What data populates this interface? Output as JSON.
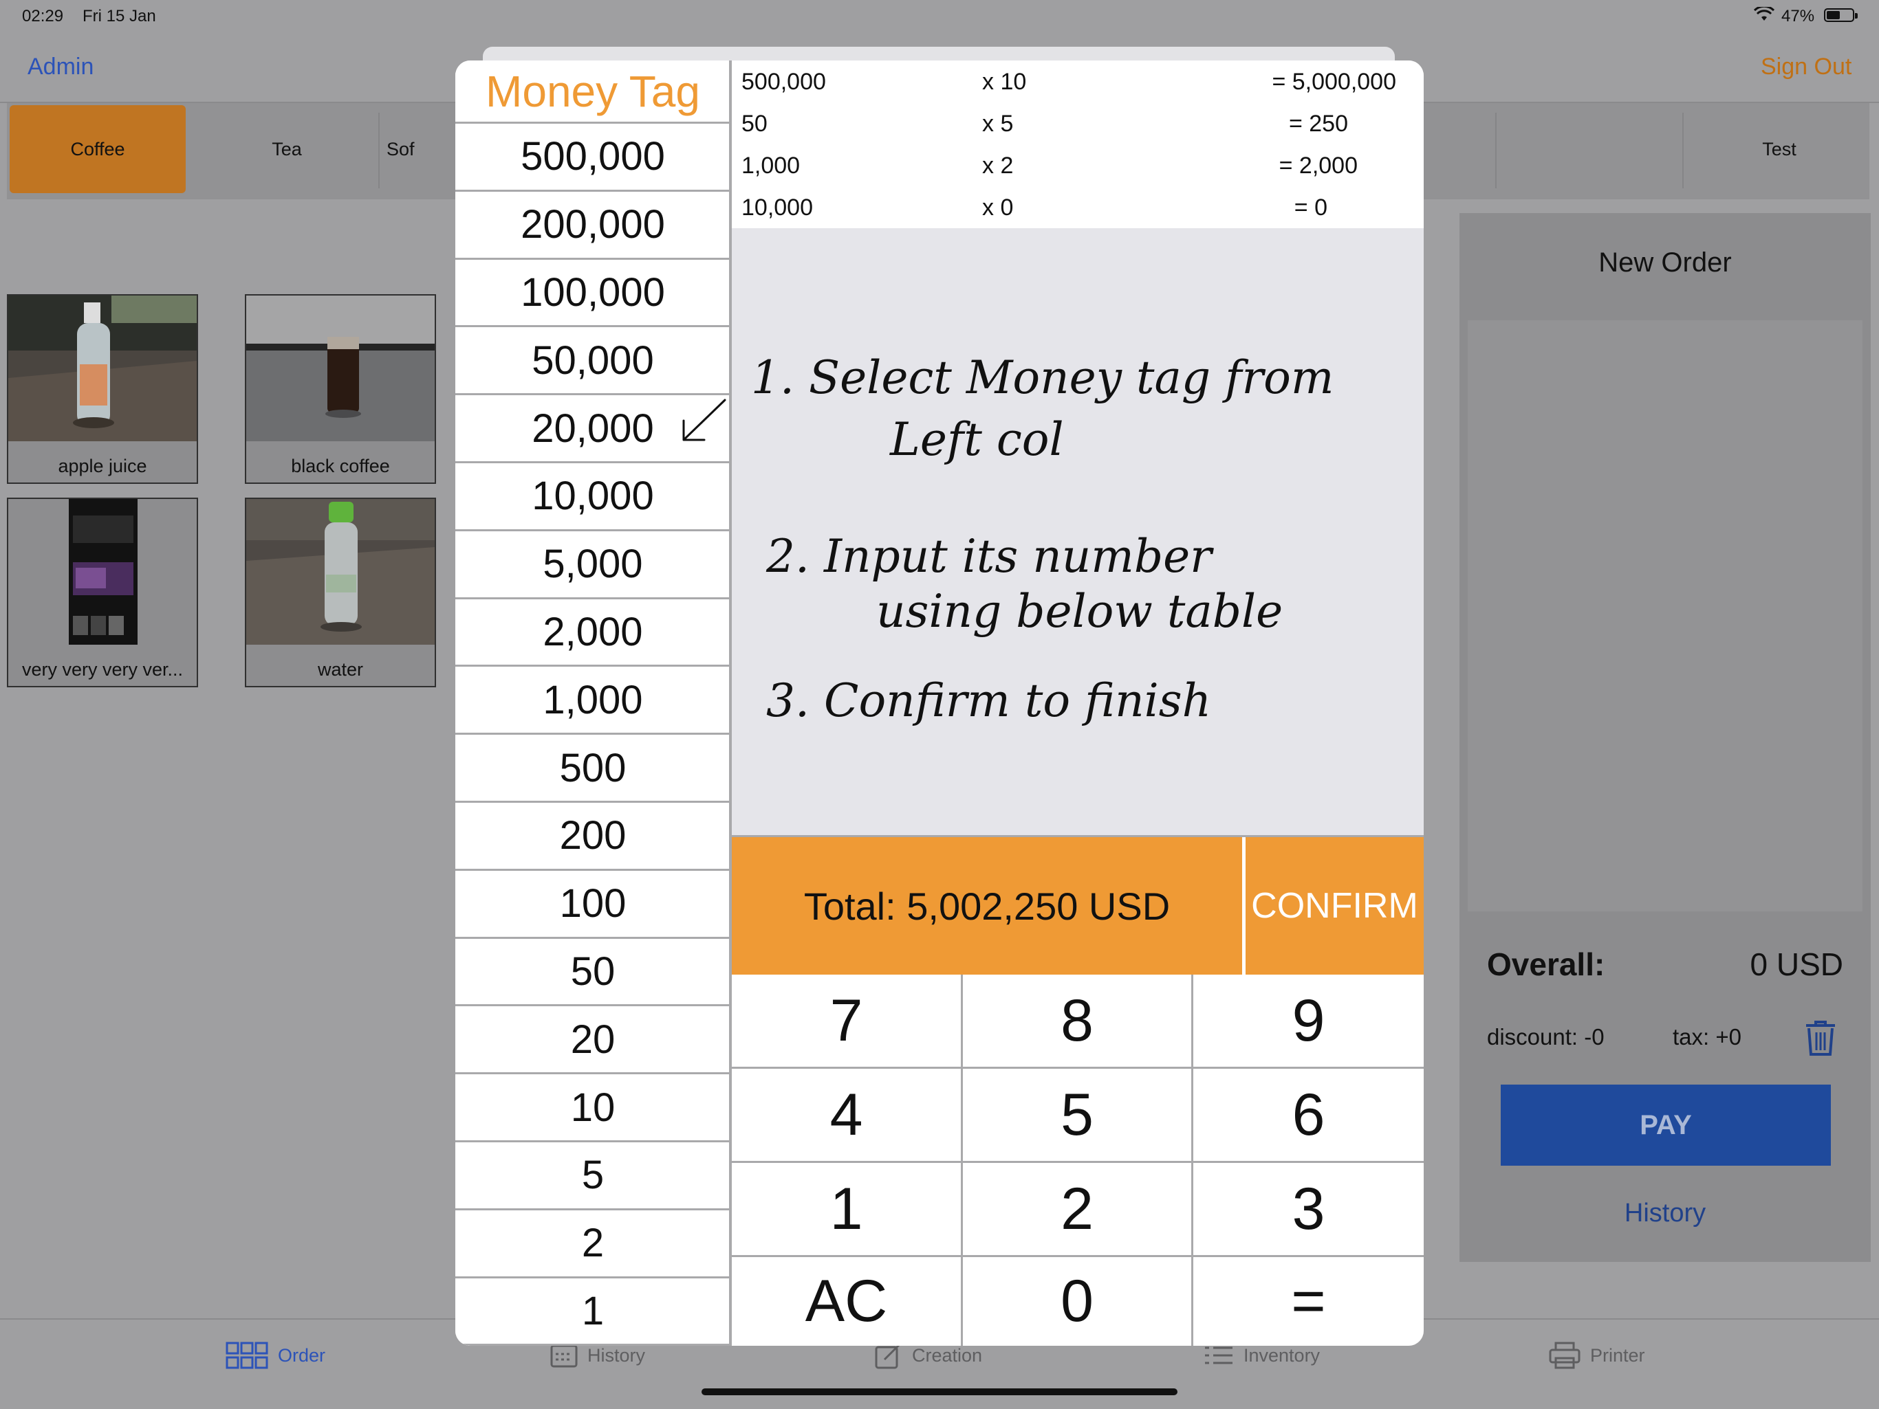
{
  "status_bar": {
    "time": "02:29",
    "date": "Fri 15 Jan",
    "battery": "47%"
  },
  "nav": {
    "admin": "Admin",
    "sign_out": "Sign Out"
  },
  "categories": [
    "Coffee",
    "Tea",
    "Sof",
    "Test"
  ],
  "products": [
    {
      "name": "apple juice"
    },
    {
      "name": "black coffee"
    },
    {
      "name": "very very very ver..."
    },
    {
      "name": "water"
    }
  ],
  "order": {
    "title": "New Order",
    "overall_label": "Overall:",
    "overall_value": "0 USD",
    "discount": "discount: -0",
    "tax": "tax: +0",
    "pay": "PAY",
    "history": "History"
  },
  "tabs": [
    {
      "label": "Order",
      "icon": "grid-icon",
      "active": true
    },
    {
      "label": "History",
      "icon": "calendar-icon"
    },
    {
      "label": "Creation",
      "icon": "pencil-square-icon"
    },
    {
      "label": "Inventory",
      "icon": "list-icon"
    },
    {
      "label": "Printer",
      "icon": "printer-icon"
    }
  ],
  "money_tag": {
    "header": "Money Tag",
    "tags": [
      "500,000",
      "200,000",
      "100,000",
      "50,000",
      "20,000",
      "10,000",
      "5,000",
      "2,000",
      "1,000",
      "500",
      "200",
      "100",
      "50",
      "20",
      "10",
      "5",
      "2",
      "1"
    ]
  },
  "entries": [
    {
      "value": "500,000",
      "mult": "x 10",
      "result": "=  5,000,000"
    },
    {
      "value": "50",
      "mult": "x 5",
      "result": "=  250"
    },
    {
      "value": "1,000",
      "mult": "x 2",
      "result": "=  2,000"
    },
    {
      "value": "10,000",
      "mult": "x 0",
      "result": "=  0"
    }
  ],
  "handwritten_note": {
    "line1": "1. Select Money tag from",
    "line2": "Left col",
    "line3": "2. Input its number",
    "line4": "using below table",
    "line5": "3. Confirm to finish"
  },
  "total": {
    "label": "Total: 5,002,250 USD",
    "confirm": "CONFIRM"
  },
  "keypad": [
    "7",
    "8",
    "9",
    "4",
    "5",
    "6",
    "1",
    "2",
    "3",
    "AC",
    "0",
    "="
  ],
  "colors": {
    "accent_orange": "#ef9a35",
    "link_blue": "#2c53b8",
    "pay_blue": "#1f4a9c"
  }
}
